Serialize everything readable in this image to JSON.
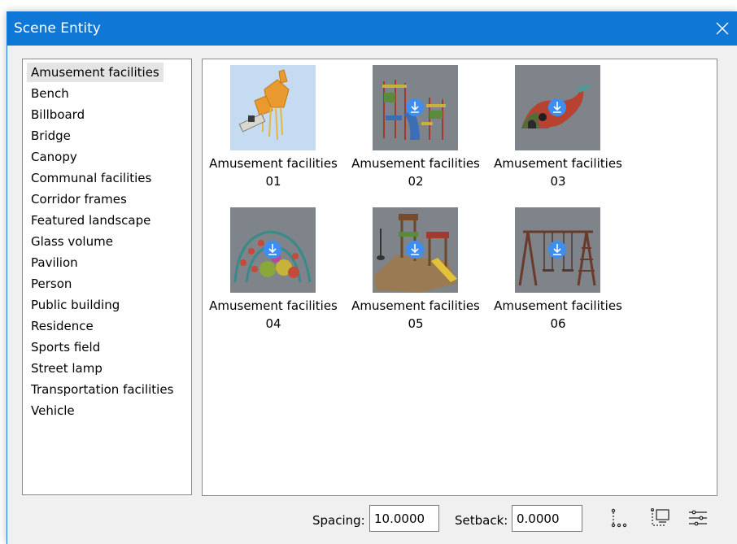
{
  "window": {
    "title": "Scene Entity"
  },
  "categories": [
    "Amusement facilities",
    "Bench",
    "Billboard",
    "Bridge",
    "Canopy",
    "Communal facilities",
    "Corridor frames",
    "Featured landscape",
    "Glass volume",
    "Pavilion",
    "Person",
    "Public building",
    "Residence",
    "Sports field",
    "Street lamp",
    "Transportation facilities",
    "Vehicle"
  ],
  "selected_category": "Amusement facilities",
  "items": [
    {
      "name": "Amusement facilities",
      "number": "01",
      "selected": true,
      "downloadable": false
    },
    {
      "name": "Amusement facilities",
      "number": "02",
      "selected": false,
      "downloadable": true
    },
    {
      "name": "Amusement facilities",
      "number": "03",
      "selected": false,
      "downloadable": true
    },
    {
      "name": "Amusement facilities",
      "number": "04",
      "selected": false,
      "downloadable": true
    },
    {
      "name": "Amusement facilities",
      "number": "05",
      "selected": false,
      "downloadable": true
    },
    {
      "name": "Amusement facilities",
      "number": "06",
      "selected": false,
      "downloadable": true
    }
  ],
  "footer": {
    "spacing_label": "Spacing:",
    "spacing_value": "10.0000",
    "setback_label": "Setback:",
    "setback_value": "0.0000",
    "tools": [
      "point-path-icon",
      "screen-place-icon",
      "settings-sliders-icon"
    ]
  },
  "colors": {
    "titlebar": "#0f78d7",
    "accent": "#3d8ef0",
    "thumb_background": "#7e8489",
    "selected_thumb_background": "#c4dbf2",
    "window_background": "#f0f0f0"
  }
}
